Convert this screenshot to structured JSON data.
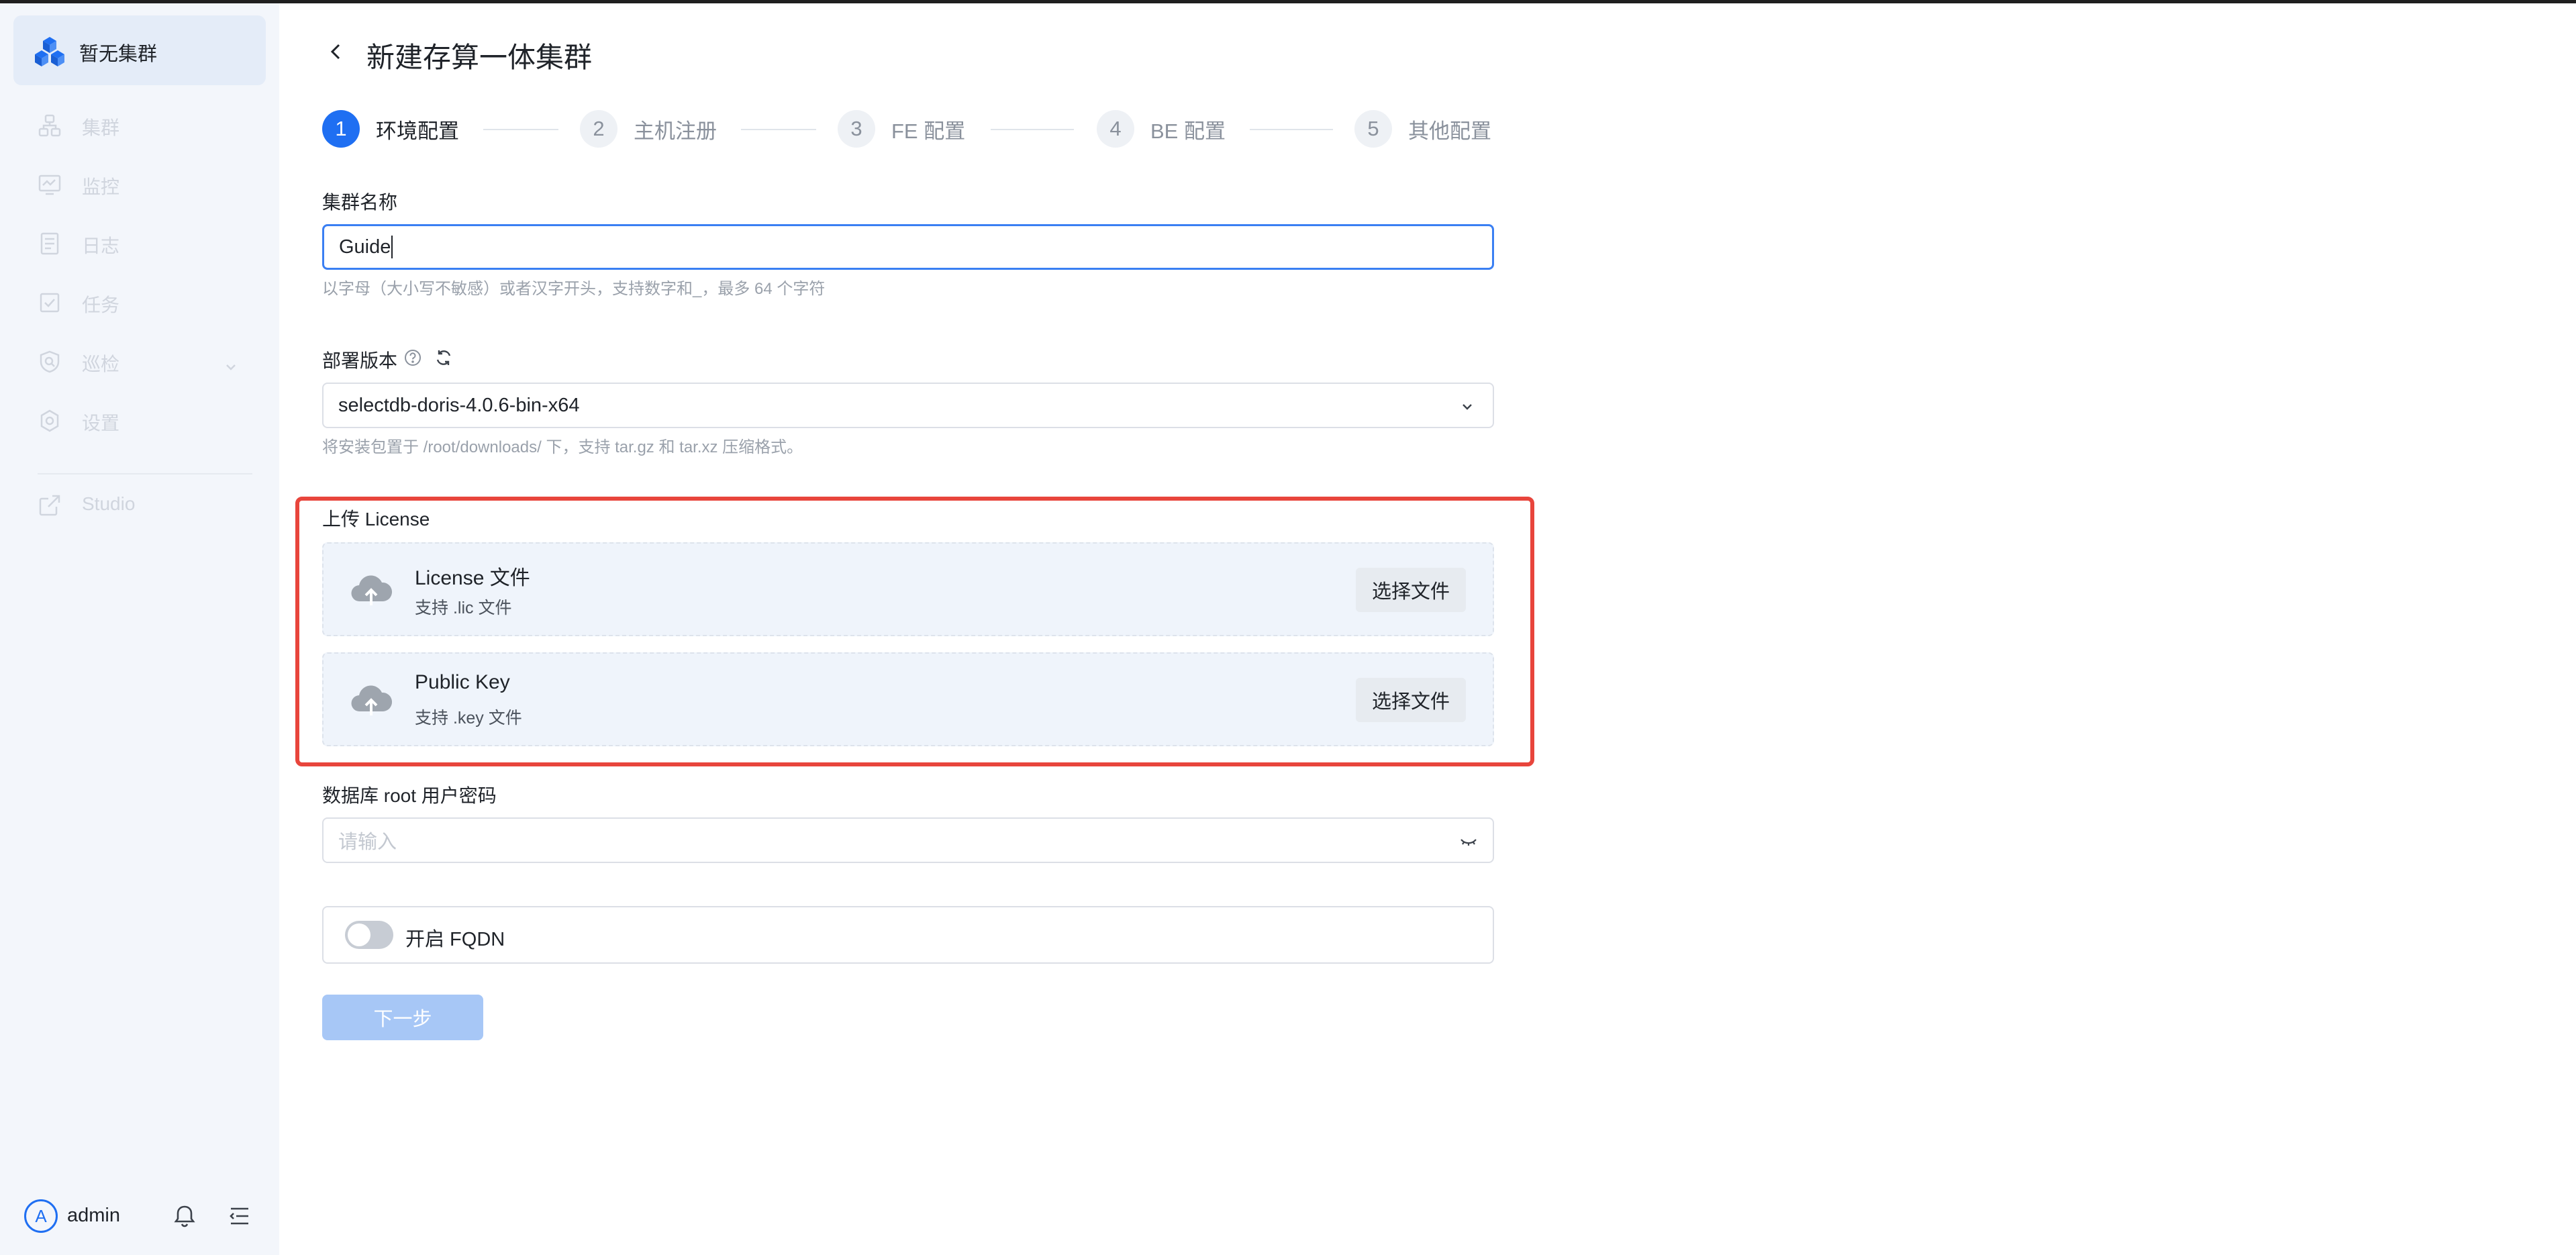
{
  "sidebar": {
    "cluster_label": "暂无集群",
    "items": [
      {
        "label": "集群",
        "icon": "cluster-icon"
      },
      {
        "label": "监控",
        "icon": "monitor-icon"
      },
      {
        "label": "日志",
        "icon": "log-icon"
      },
      {
        "label": "任务",
        "icon": "task-icon"
      },
      {
        "label": "巡检",
        "icon": "inspect-icon"
      },
      {
        "label": "设置",
        "icon": "settings-icon"
      },
      {
        "label": "Studio",
        "icon": "external-link-icon"
      }
    ],
    "footer": {
      "avatar_letter": "A",
      "username": "admin"
    }
  },
  "header": {
    "title": "新建存算一体集群"
  },
  "steps": [
    {
      "number": "1",
      "label": "环境配置",
      "active": true
    },
    {
      "number": "2",
      "label": "主机注册",
      "active": false
    },
    {
      "number": "3",
      "label": "FE 配置",
      "active": false
    },
    {
      "number": "4",
      "label": "BE 配置",
      "active": false
    },
    {
      "number": "5",
      "label": "其他配置",
      "active": false
    }
  ],
  "form": {
    "cluster_name": {
      "label": "集群名称",
      "value": "Guide",
      "hint": "以字母（大小写不敏感）或者汉字开头，支持数字和_，最多 64 个字符"
    },
    "version": {
      "label": "部署版本",
      "value": "selectdb-doris-4.0.6-bin-x64",
      "hint": "将安装包置于 /root/downloads/ 下，支持 tar.gz 和 tar.xz 压缩格式。"
    },
    "license": {
      "label": "上传 License",
      "license_file": {
        "title": "License 文件",
        "sub": "支持 .lic 文件",
        "button": "选择文件"
      },
      "public_key": {
        "title": "Public Key",
        "sub": "支持 .key 文件",
        "button": "选择文件"
      }
    },
    "password": {
      "label": "数据库 root 用户密码",
      "placeholder": "请输入"
    },
    "fqdn": {
      "label": "开启 FQDN"
    },
    "next_button": "下一步"
  },
  "colors": {
    "primary": "#1f6ff2",
    "highlight": "#e8453c",
    "disabled_button": "#a7c7f6"
  }
}
